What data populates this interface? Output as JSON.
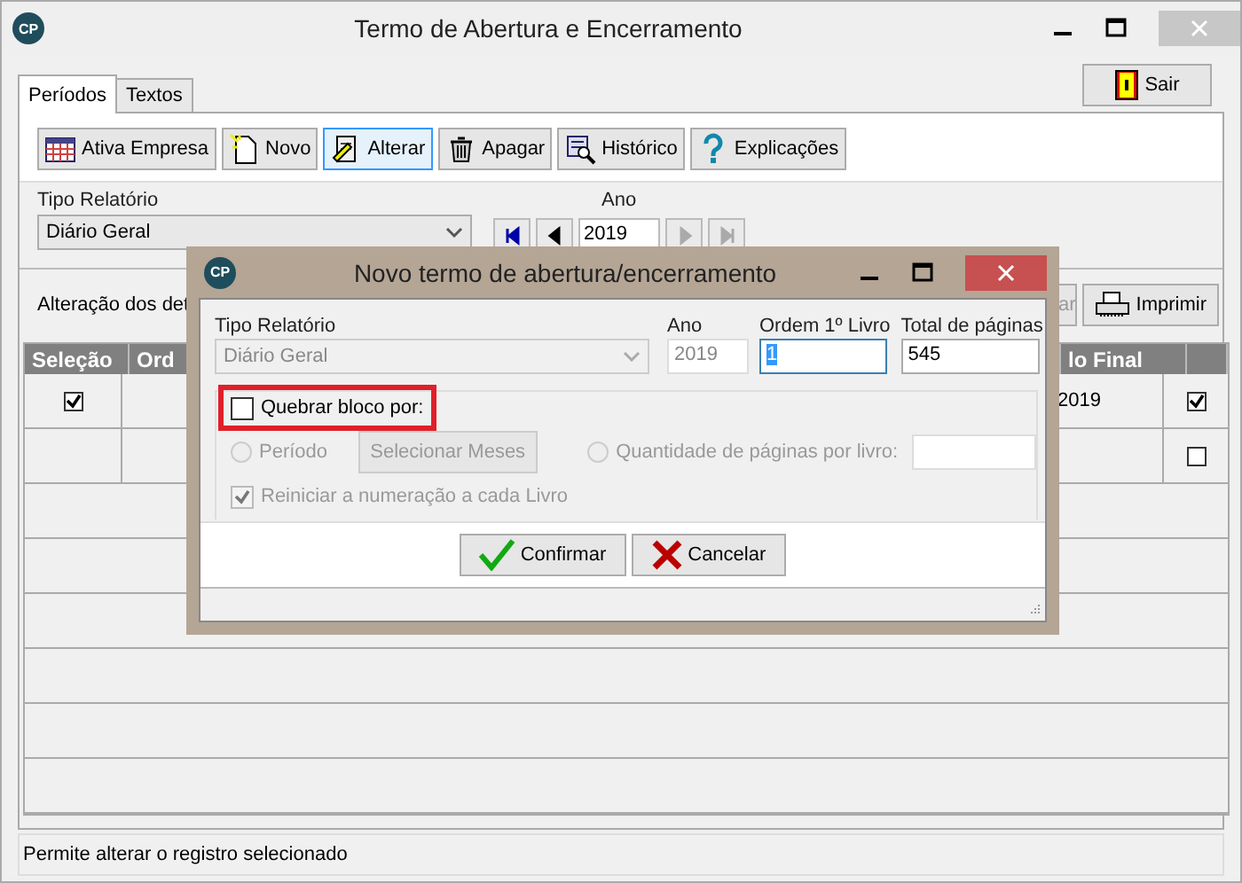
{
  "window": {
    "logo": "CP",
    "title": "Termo de Abertura e Encerramento"
  },
  "exit_button": "Sair",
  "tabs": [
    {
      "label": "Períodos",
      "selected": true
    },
    {
      "label": "Textos",
      "selected": false
    }
  ],
  "toolbar": [
    {
      "label": "Ativa Empresa",
      "selected": false
    },
    {
      "label": "Novo",
      "selected": false
    },
    {
      "label": "Alterar",
      "selected": true
    },
    {
      "label": "Apagar",
      "selected": false
    },
    {
      "label": "Histórico",
      "selected": false
    },
    {
      "label": "Explicações",
      "selected": false
    }
  ],
  "filter": {
    "report_label": "Tipo Relatório",
    "report_value": "Diário Geral",
    "year_label": "Ano",
    "year_value": "2019",
    "nav": [
      {
        "kind": "first",
        "disabled": false
      },
      {
        "kind": "prev",
        "disabled": false
      },
      {
        "kind": "next",
        "disabled": true
      },
      {
        "kind": "last",
        "disabled": true
      }
    ]
  },
  "details_label": "Alteração dos det",
  "partial_button": {
    "label": "ar",
    "disabled": true
  },
  "print_button": "Imprimir",
  "grid": {
    "columns": [
      "Seleção",
      "Ord",
      "lo Final"
    ],
    "rows": [
      {
        "selection": true,
        "final": "2019",
        "flag": true
      },
      {
        "flag": false
      }
    ]
  },
  "status_bar": "Permite alterar o registro selecionado",
  "dialog": {
    "logo": "CP",
    "title": "Novo termo de abertura/encerramento",
    "report_label": "Tipo Relatório",
    "report_value": "Diário Geral",
    "report_disabled": true,
    "year_label": "Ano",
    "year_value": "2019",
    "order_label": "Ordem 1º Livro",
    "order_value": "1",
    "total_label": "Total de páginas",
    "total_value": "545",
    "break_checkbox": {
      "label": "Quebrar bloco por:",
      "checked": false,
      "highlighted": true
    },
    "period_radio": {
      "label": "Período",
      "selected": false,
      "disabled": true
    },
    "months_button": {
      "label": "Selecionar Meses",
      "disabled": true
    },
    "pages_radio": {
      "label": "Quantidade de páginas por livro:",
      "selected": false,
      "disabled": true
    },
    "restart_checkbox": {
      "label": "Reiniciar a numeração a cada Livro",
      "checked": true,
      "disabled": true
    },
    "buttons": [
      {
        "kind": "confirm",
        "label": "Confirmar"
      },
      {
        "kind": "cancel",
        "label": "Cancelar"
      }
    ]
  }
}
